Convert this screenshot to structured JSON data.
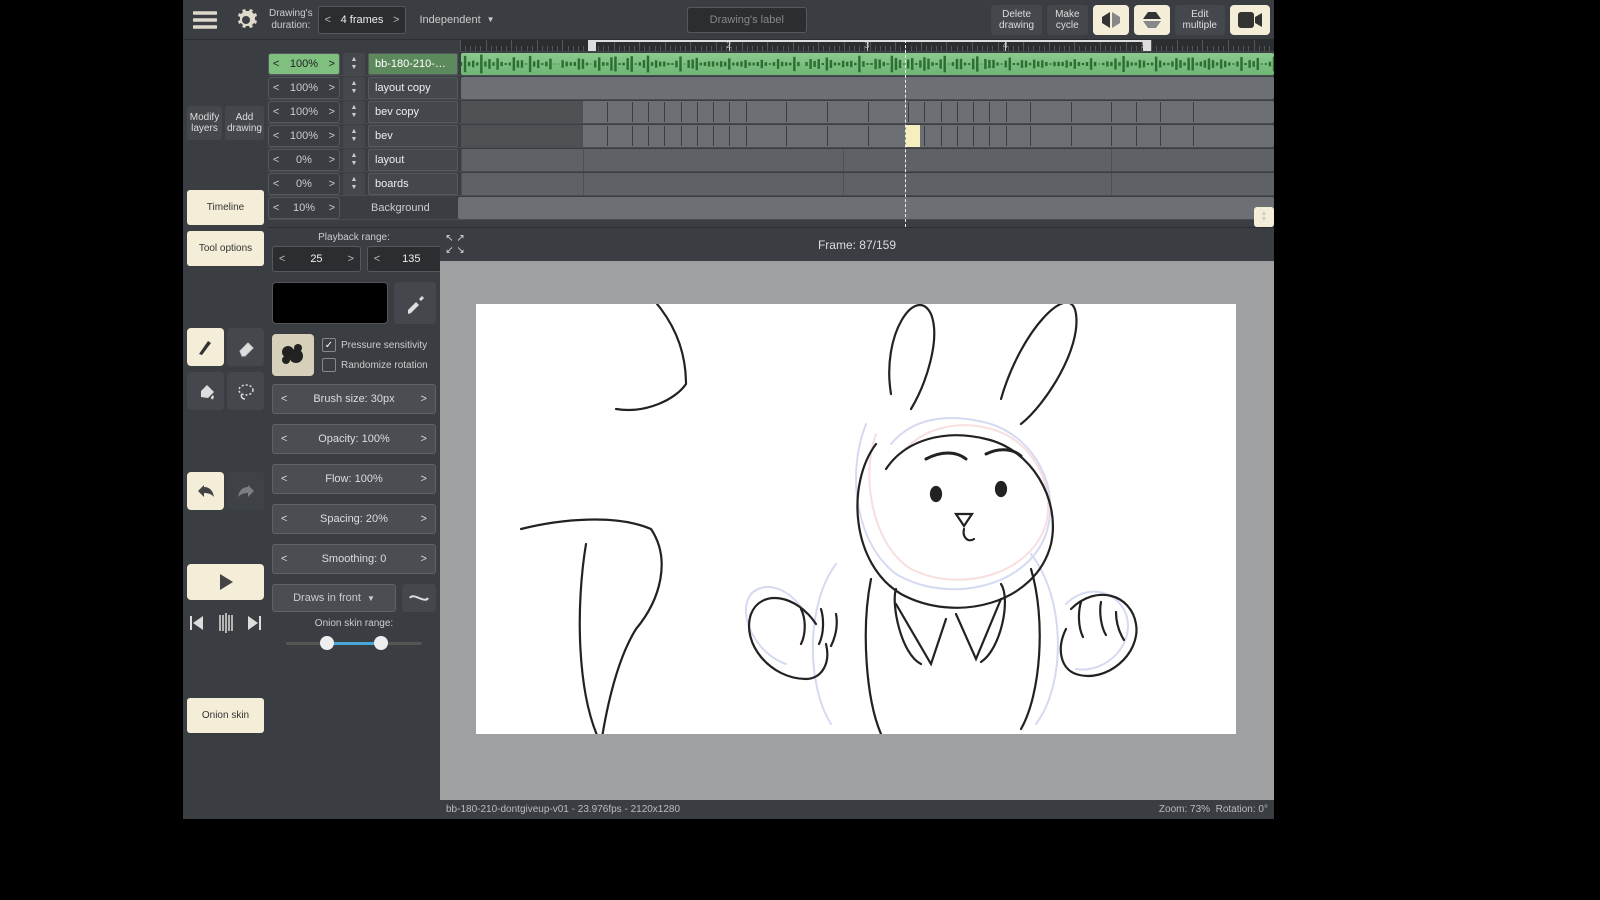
{
  "topbar": {
    "duration_label": "Drawing's\nduration:",
    "duration_value": "4 frames",
    "mode": "Independent",
    "drawing_label_placeholder": "Drawing's label",
    "delete": "Delete\ndrawing",
    "make_cycle": "Make\ncycle",
    "edit_multiple": "Edit\nmultiple"
  },
  "leftbar": {
    "modify": "Modify\nlayers",
    "add": "Add\ndrawing",
    "timeline": "Timeline",
    "tool_options": "Tool options",
    "onion_skin": "Onion skin"
  },
  "timeline": {
    "playhead_frame": 87,
    "total_frames": 159,
    "frame_display": "Frame: 87/159",
    "ruler_breaks": [
      1,
      2,
      3,
      4,
      5
    ],
    "layers": [
      {
        "opacity": "100%",
        "name": "bb-180-210-…",
        "type": "audio",
        "selected": true
      },
      {
        "opacity": "100%",
        "name": "layout copy",
        "type": "empty"
      },
      {
        "opacity": "100%",
        "name": "bev copy",
        "type": "keys"
      },
      {
        "opacity": "100%",
        "name": "bev",
        "type": "keys_current"
      },
      {
        "opacity": "0%",
        "name": "layout",
        "type": "seg"
      },
      {
        "opacity": "0%",
        "name": "boards",
        "type": "seg"
      },
      {
        "opacity": "10%",
        "name": "Background",
        "type": "bg"
      }
    ],
    "playback_label": "Playback range:",
    "range_from": "25",
    "range_to": "135"
  },
  "opts": {
    "pressure": "Pressure sensitivity",
    "pressure_on": true,
    "randomize": "Randomize rotation",
    "randomize_on": false,
    "brush_size": "Brush size:  30px",
    "opacity": "Opacity:  100%",
    "flow": "Flow:  100%",
    "spacing": "Spacing:  20%",
    "smoothing": "Smoothing:  0",
    "draws": "Draws in front",
    "onion_label": "Onion skin range:"
  },
  "status": {
    "file": "bb-180-210-dontgiveup-v01 - 23.976fps - 2120x1280",
    "zoom": "Zoom: 73%",
    "rotation": "Rotation: 0°"
  }
}
